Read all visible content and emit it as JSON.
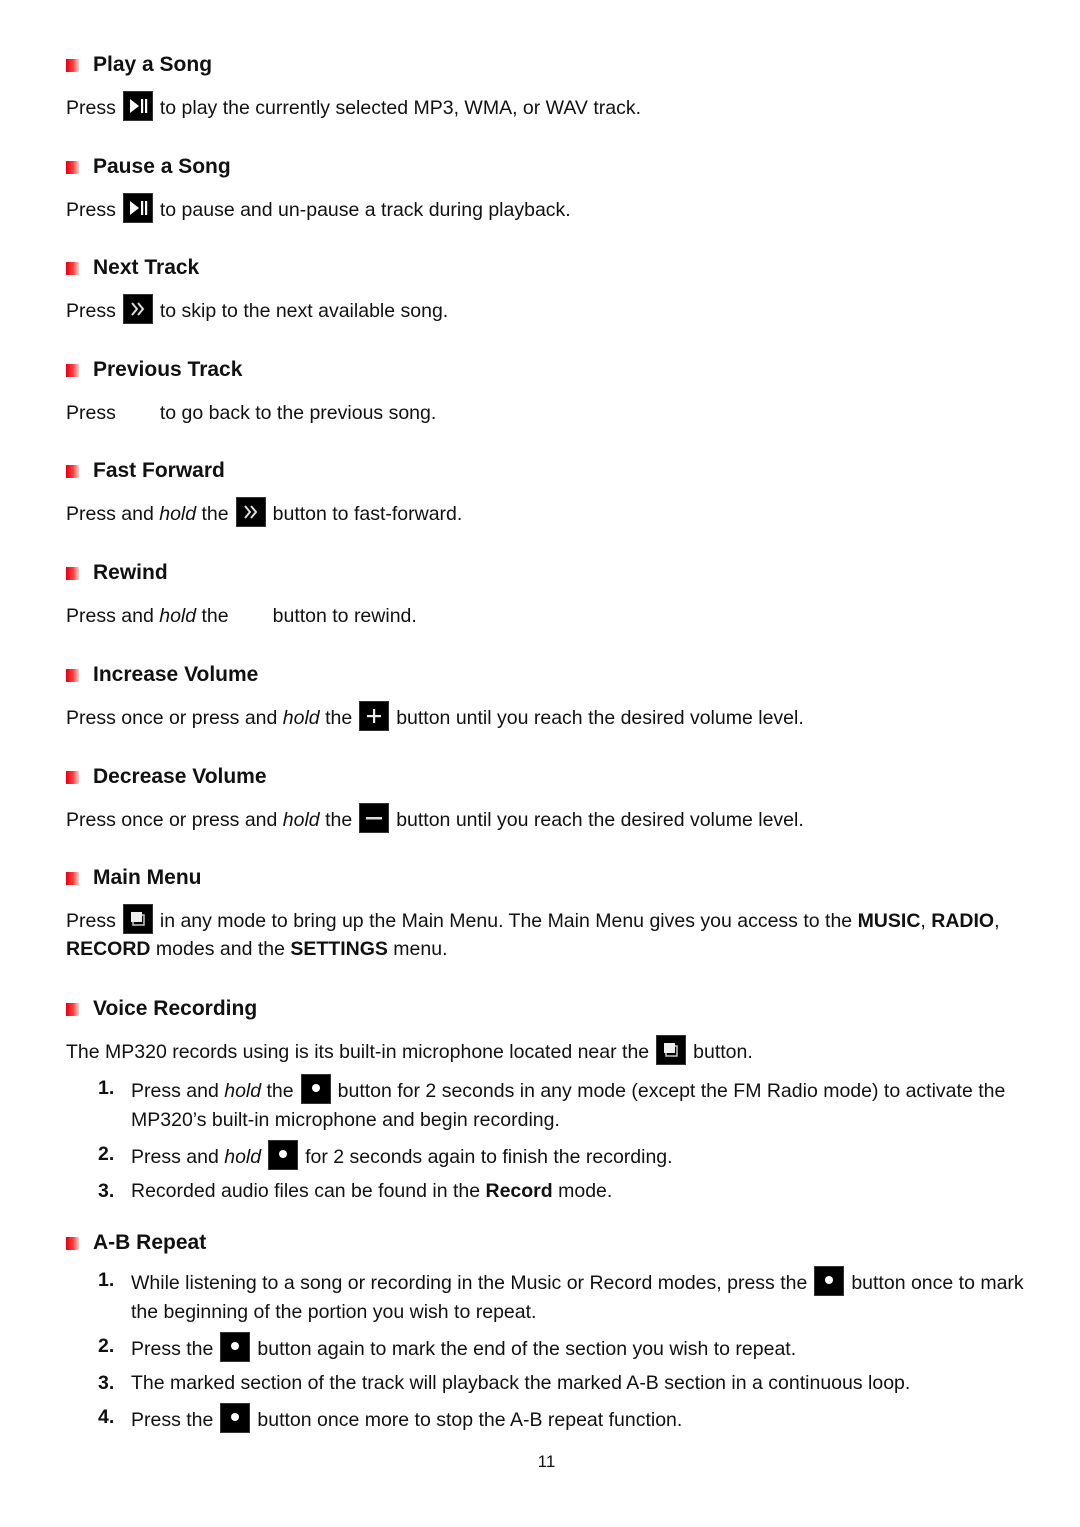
{
  "accent_color": "#e00010",
  "sections": [
    {
      "heading": "Play a Song",
      "pre": "Press",
      "icon": "play-pause-icon",
      "post": "to play the currently selected MP3, WMA, or WAV track."
    },
    {
      "heading": "Pause a Song",
      "pre": "Press",
      "icon": "play-pause-icon",
      "post": "to pause and un-pause a track during playback."
    },
    {
      "heading": "Next Track",
      "pre": "Press",
      "icon": "next-icon",
      "post": "to skip to the next available song."
    },
    {
      "heading": "Previous Track",
      "pre": "Press",
      "icon": "previous-icon-missing",
      "post": "to go back to the previous song."
    },
    {
      "heading": "Fast Forward",
      "pre1": "Press and ",
      "em": "hold",
      "pre2": " the",
      "icon": "next-icon",
      "post": "button to fast-forward."
    },
    {
      "heading": "Rewind",
      "pre1": "Press and ",
      "em": "hold",
      "pre2": " the",
      "icon": "previous-icon-missing",
      "post": "button to rewind."
    },
    {
      "heading": "Increase Volume",
      "pre1": "Press once or press and ",
      "em": "hold",
      "pre2": " the",
      "icon": "plus-icon",
      "post": "button until you reach the desired volume level."
    },
    {
      "heading": "Decrease Volume",
      "pre1": "Press once or press and ",
      "em": "hold",
      "pre2": " the",
      "icon": "minus-icon",
      "post": "button until you reach the desired volume level."
    },
    {
      "heading": "Main Menu",
      "pre": "Press",
      "icon": "menu-icon",
      "post": "in any mode to bring up the Main Menu. The Main Menu gives you access to the",
      "b1": "MUSIC",
      ",": ",",
      "b2": "RADIO",
      "b3": "RECORD",
      "mid": " modes and the ",
      "b4": "SETTINGS",
      "end": " menu."
    },
    {
      "heading": "Voice Recording",
      "intro_pre": "The MP320 records using is its built-in microphone located near the",
      "intro_post": "button.",
      "steps": [
        {
          "num": "1.",
          "a": "Press and ",
          "em": "hold",
          "b": " the",
          "c": "button for 2 seconds in any mode (except the FM Radio mode) to activate the MP320’s built-in microphone and begin recording."
        },
        {
          "num": "2.",
          "a": "Press and ",
          "em": "hold",
          "c": "for 2 seconds again to finish the recording."
        },
        {
          "num": "3.",
          "a": "Recorded audio files can be found in the ",
          "bold": "Record",
          "c": " mode."
        }
      ]
    },
    {
      "heading": "A-B Repeat",
      "steps": [
        {
          "num": "1.",
          "a": "While listening to a song or recording in the Music or Record modes, press the",
          "c": "button once to mark the beginning of the portion you wish to repeat."
        },
        {
          "num": "2.",
          "a": "Press the",
          "c": "button again to mark the end of the section you wish to repeat."
        },
        {
          "num": "3.",
          "a": "The marked section of the track will playback the marked A-B section in a continuous loop."
        },
        {
          "num": "4.",
          "a": "Press the",
          "c": "button once more to stop the A-B repeat function."
        }
      ]
    }
  ],
  "page_number": "11"
}
